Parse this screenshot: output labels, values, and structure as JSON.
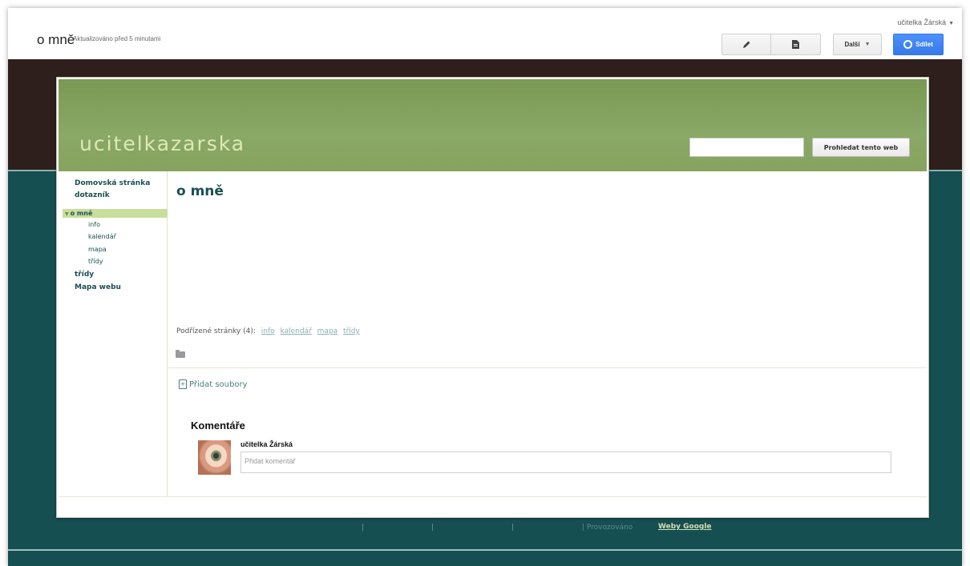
{
  "topbar": {
    "user": "učitelka Žárská",
    "page_title": "o mně",
    "updated": "Aktualizováno před 5 minutami",
    "more_label": "Další",
    "share_label": "Sdílet"
  },
  "site": {
    "title": "ucitelkazarska",
    "search_button": "Prohledat tento web"
  },
  "sidebar": {
    "items": [
      {
        "label": "Domovská stránka"
      },
      {
        "label": "dotazník"
      },
      {
        "label": "o mně"
      },
      {
        "label": "třídy"
      },
      {
        "label": "Mapa webu"
      }
    ],
    "subitems": [
      {
        "label": "info"
      },
      {
        "label": "kalendář"
      },
      {
        "label": "mapa"
      },
      {
        "label": "třídy"
      }
    ]
  },
  "main": {
    "heading": "o mně",
    "subpages_label": "Podřízené stránky (4):",
    "subpages": [
      "info",
      "kalendář",
      "mapa",
      "třídy"
    ],
    "add_files": "Přidat soubory",
    "comments_heading": "Komentáře",
    "comment_user": "učitelka Žárská",
    "comment_placeholder": "Přidat komentář"
  },
  "footer": {
    "powered_by": "Provozováno",
    "google_sites": "Weby Google"
  },
  "colors": {
    "header_green": "#8aa866",
    "teal_bg": "#164f52",
    "dark_band": "#2e1f1d",
    "share_blue": "#4d90fe"
  }
}
